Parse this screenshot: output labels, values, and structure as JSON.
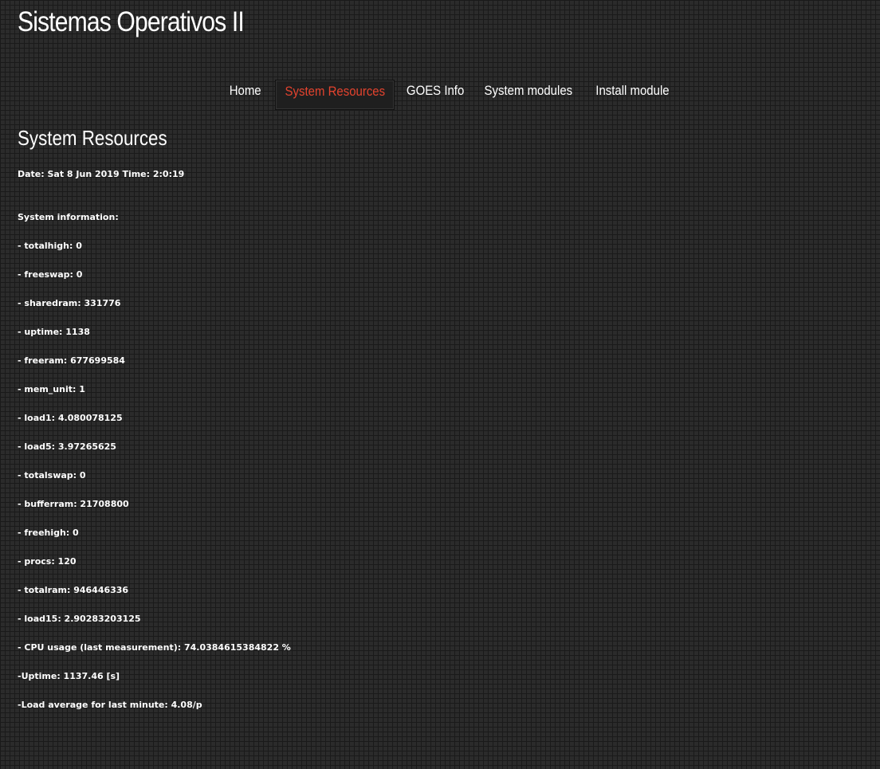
{
  "site": {
    "title": "Sistemas Operativos II"
  },
  "nav": {
    "items": [
      {
        "label": "Home"
      },
      {
        "label": "System Resources",
        "active": true
      },
      {
        "label": "GOES Info"
      },
      {
        "label": "System modules"
      },
      {
        "label": "Install module"
      }
    ]
  },
  "main": {
    "heading": "System Resources",
    "date_line": "Date: Sat 8 Jun 2019 Time: 2:0:19",
    "sysinfo_title": "System information:",
    "lines": [
      "- totalhigh: 0",
      "- freeswap: 0",
      "- sharedram: 331776",
      "- uptime: 1138",
      "- freeram: 677699584",
      "- mem_unit: 1",
      "- load1: 4.080078125",
      "- load5: 3.97265625",
      "- totalswap: 0",
      "- bufferram: 21708800",
      "- freehigh: 0",
      "- procs: 120",
      "- totalram: 946446336",
      "- load15: 2.90283203125",
      "- CPU usage (last measurement): 74.0384615384822 %",
      "-Uptime: 1137.46 [s]",
      "-Load average for last minute: 4.08/p"
    ]
  },
  "colors": {
    "accent": "#e4432e",
    "background": "#2b2b2b",
    "text": "#ffffff"
  }
}
